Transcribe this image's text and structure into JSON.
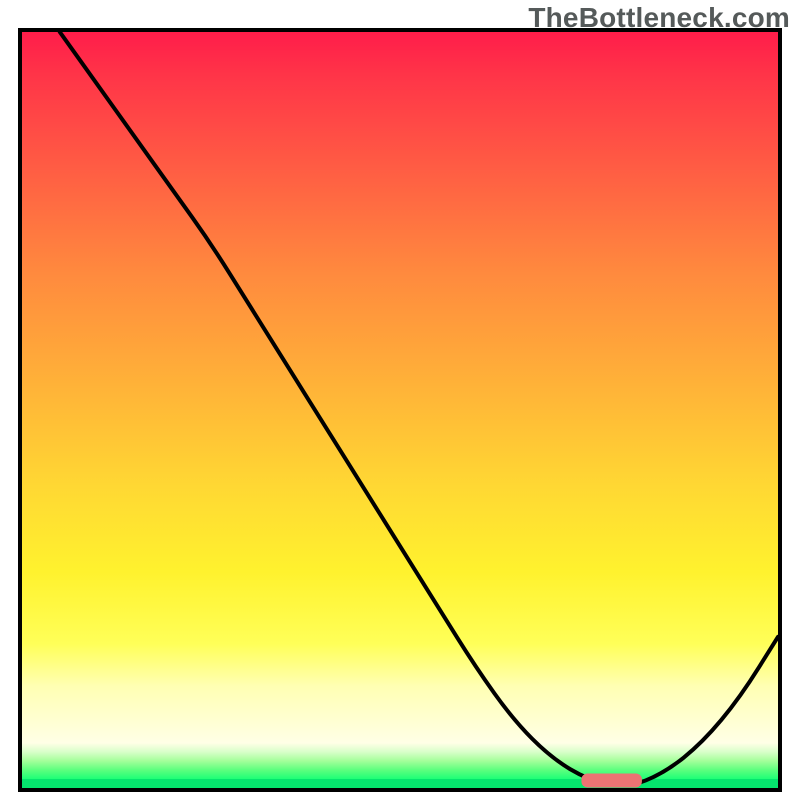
{
  "watermark": "TheBottleneck.com",
  "chart_data": {
    "type": "line",
    "title": "",
    "xlabel": "",
    "ylabel": "",
    "xlim": [
      0,
      100
    ],
    "ylim": [
      0,
      100
    ],
    "grid": false,
    "series": [
      {
        "name": "bottleneck-curve",
        "x": [
          5,
          10,
          15,
          20,
          25,
          30,
          35,
          40,
          45,
          50,
          55,
          60,
          65,
          70,
          75,
          80,
          85,
          90,
          95,
          100
        ],
        "values": [
          100,
          93,
          86,
          79,
          72,
          64,
          56,
          48,
          40,
          32,
          24,
          16,
          9,
          4,
          1,
          0,
          2,
          6,
          12,
          20
        ]
      }
    ],
    "optimal_marker": {
      "x_start": 74,
      "x_end": 82,
      "y": 1
    },
    "heat_gradient": {
      "top": "#ff1d4a",
      "mid": "#ffd833",
      "low": "#ffffb3",
      "good": "#05e56d"
    }
  }
}
